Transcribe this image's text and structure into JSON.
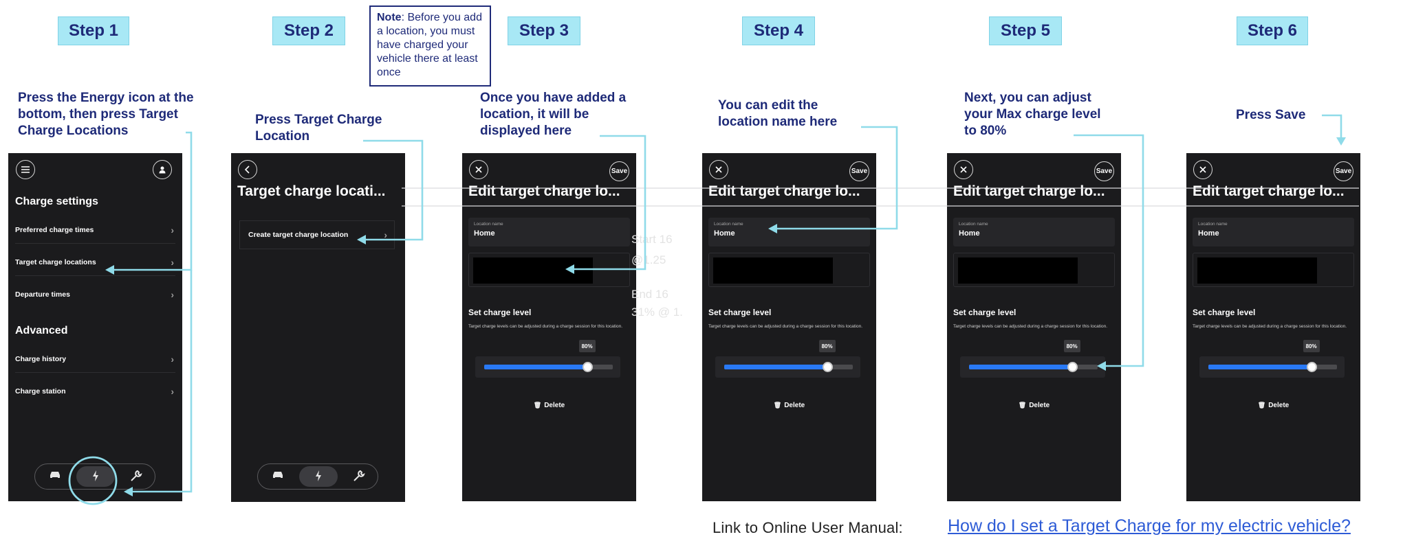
{
  "steps": [
    "Step 1",
    "Step 2",
    "Step 3",
    "Step 4",
    "Step 5",
    "Step 6"
  ],
  "note": {
    "label": "Note",
    "text": ": Before you add a location, you must have charged your vehicle there at least once"
  },
  "captions": {
    "step1": "Press the Energy icon at the bottom, then press Target Charge Locations",
    "step2": "Press Target Charge Location",
    "step3": "Once you have added a location, it will be displayed here",
    "step4": "You can edit the location name here",
    "step5": "Next, you can adjust your Max charge level to 80%",
    "step6": "Press Save"
  },
  "screen1": {
    "section1": "Charge settings",
    "items1": [
      "Preferred charge times",
      "Target charge locations",
      "Departure times"
    ],
    "section2": "Advanced",
    "items2": [
      "Charge history",
      "Charge station"
    ]
  },
  "screen2": {
    "title": "Target charge locati...",
    "create_label": "Create target charge location"
  },
  "edit_screen": {
    "title": "Edit target charge lo...",
    "save_label": "Save",
    "location_label": "Location name",
    "location_value": "Home",
    "set_level_label": "Set charge level",
    "hint": "Target charge levels can be adjusted during a charge session for this location.",
    "level_text": "80%",
    "level_fraction": 0.8,
    "delete_label": "Delete"
  },
  "icons": {
    "menu": "menu-icon",
    "profile": "profile-icon",
    "back": "back-icon",
    "close": "close-icon",
    "car": "car-icon",
    "energy": "energy-icon",
    "wrench": "wrench-icon",
    "trash": "trash-icon"
  },
  "colors": {
    "accent": "#2979f5",
    "badge": "#a8e8f5",
    "caption": "#1e2a78",
    "arrow": "#8fdbe9",
    "screen_bg": "#1b1b1d"
  },
  "footer": {
    "label": "Link to Online User Manual:",
    "link_text": "How do I set a Target Charge for my electric vehicle?"
  }
}
